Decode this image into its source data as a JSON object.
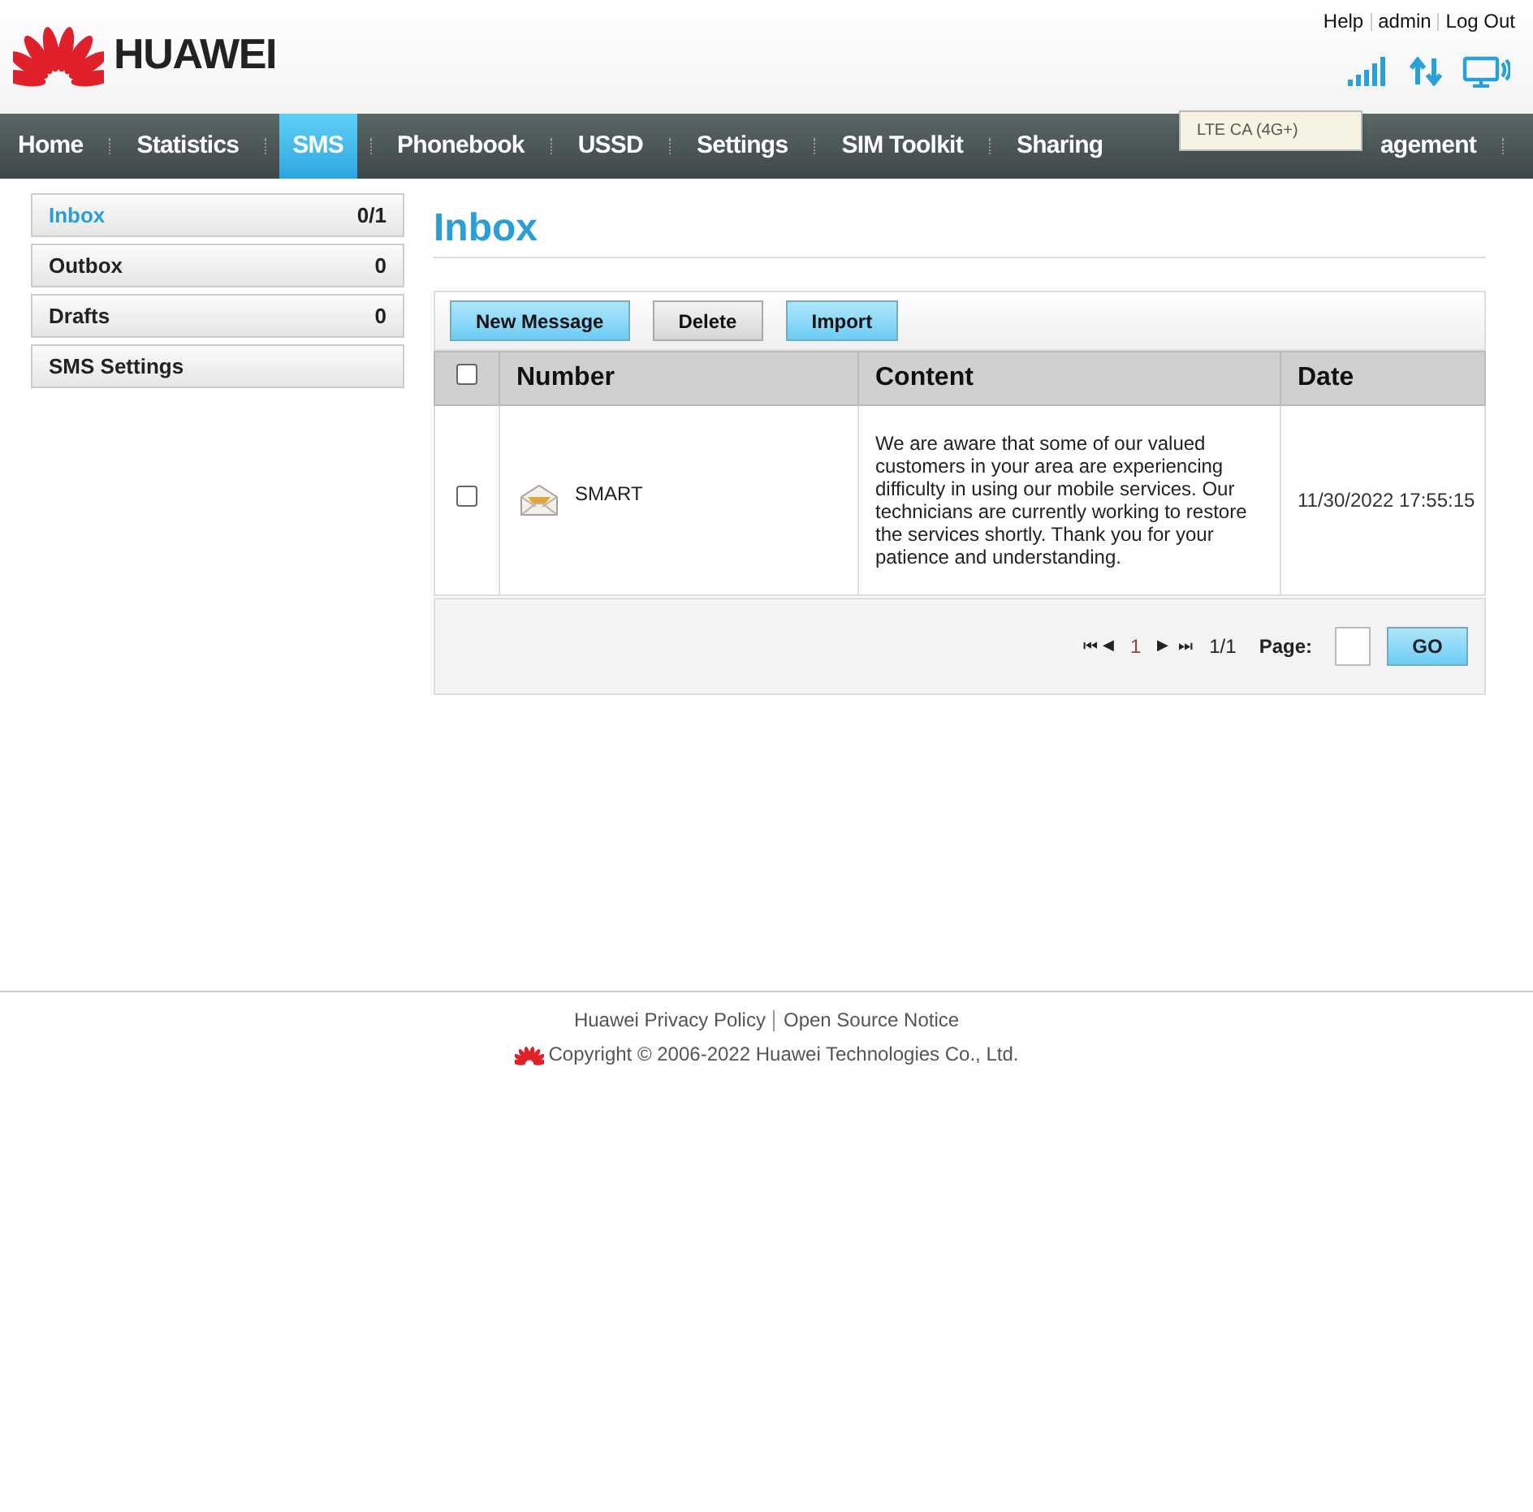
{
  "header": {
    "logo": "HUAWEI",
    "links": [
      "Help",
      "admin",
      "Log Out"
    ],
    "tooltip": "LTE CA (4G+)"
  },
  "nav": [
    {
      "label": "Home",
      "selected": false
    },
    {
      "label": "Statistics",
      "selected": false
    },
    {
      "label": "SMS",
      "selected": true
    },
    {
      "label": "Phonebook",
      "selected": false
    },
    {
      "label": "USSD",
      "selected": false
    },
    {
      "label": "Settings",
      "selected": false
    },
    {
      "label": "SIM Toolkit",
      "selected": false
    },
    {
      "label": "Sharing",
      "selected": false
    },
    {
      "label": "agement",
      "selected": false
    }
  ],
  "sidebar": [
    {
      "label": "Inbox",
      "count": "0/1",
      "selected": true
    },
    {
      "label": "Outbox",
      "count": "0",
      "selected": false
    },
    {
      "label": "Drafts",
      "count": "0",
      "selected": false
    },
    {
      "label": "SMS Settings",
      "selected": false
    }
  ],
  "title": "Inbox",
  "toolbar": [
    {
      "label": "New Message",
      "kind": "primary"
    },
    {
      "label": "Delete",
      "kind": "secondary"
    },
    {
      "label": "Import",
      "kind": "primary"
    }
  ],
  "table": {
    "select_all_checked": false,
    "columns": [
      "Number",
      "Content",
      "Date"
    ],
    "rows": [
      {
        "checked": false,
        "number": "SMART",
        "content": "We are aware that some of our valued customers in your area are experiencing difficulty in using our mobile services. Our technicians are currently working to restore the services shortly. Thank you for your patience and understanding.",
        "date": "11/30/2022 17:55:15"
      }
    ]
  },
  "pagination": {
    "first": "⏮",
    "prev": "◀",
    "page": "1",
    "next": "▶",
    "last": "⏭",
    "total": "1/1",
    "page_label": "Page:",
    "go": "GO"
  },
  "footer": {
    "links": [
      "Huawei Privacy Policy",
      "Open Source Notice"
    ],
    "copyright": "Copyright © 2006-2022 Huawei Technologies Co., Ltd."
  }
}
